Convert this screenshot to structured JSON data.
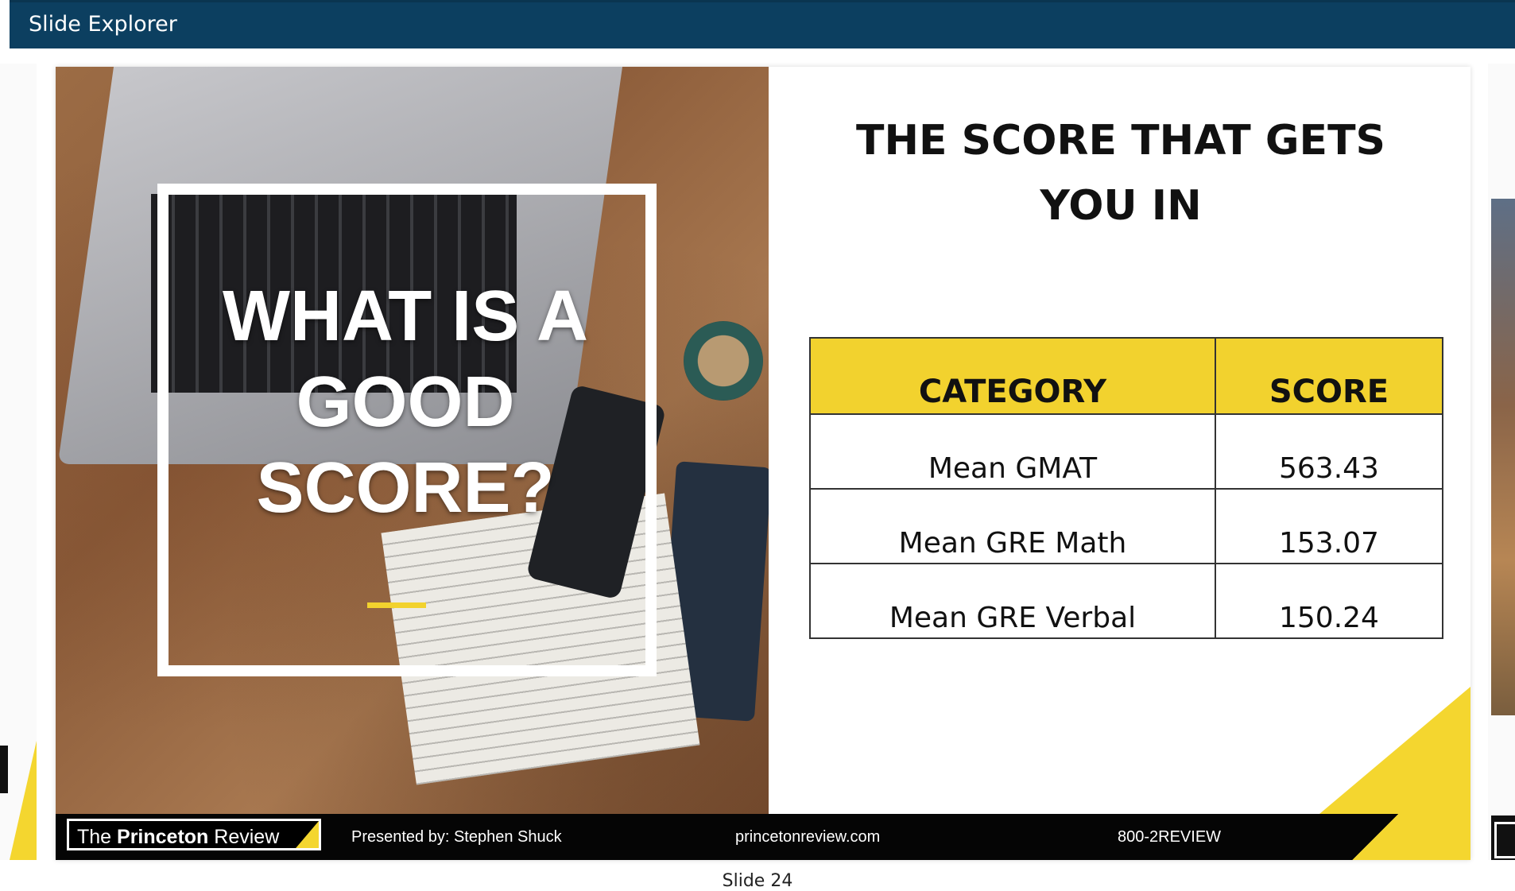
{
  "window": {
    "title": "Slide Explorer"
  },
  "slide": {
    "left_panel": {
      "question": "WHAT IS A GOOD SCORE?"
    },
    "right_panel": {
      "title": "THE SCORE THAT GETS YOU IN",
      "table": {
        "headers": [
          "CATEGORY",
          "SCORE"
        ],
        "rows": [
          {
            "category": "Mean GMAT",
            "score": "563.43"
          },
          {
            "category": "Mean GRE Math",
            "score": "153.07"
          },
          {
            "category": "Mean GRE Verbal",
            "score": "150.24"
          }
        ]
      }
    },
    "footer": {
      "logo_prefix": "The ",
      "logo_bold": "Princeton",
      "logo_suffix": " Review",
      "presenter": "Presented by: Stephen Shuck",
      "website": "princetonreview.com",
      "phone": "800-2REVIEW"
    },
    "colors": {
      "accent_yellow": "#f2d22e",
      "titlebar": "#0c3f60",
      "footer": "#050505"
    }
  },
  "caption": "Slide 24"
}
